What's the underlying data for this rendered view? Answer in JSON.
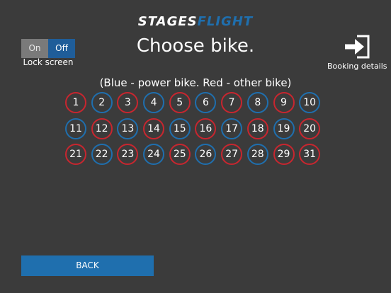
{
  "header": {
    "logo_part1": "STAGES",
    "logo_part2": "FLIGHT",
    "title": "Choose bike."
  },
  "lock": {
    "on_label": "On",
    "off_label": "Off",
    "label": "Lock screen",
    "selected": "Off"
  },
  "booking": {
    "label": "Booking details",
    "icon": "exit-door-arrow-icon"
  },
  "legend": "(Blue - power bike. Red - other bike)",
  "colors": {
    "power_bike": "#1f6fae",
    "other_bike": "#c8262f",
    "background": "#3b3b3b",
    "accent": "#1f6fae"
  },
  "bikes": [
    {
      "number": "1",
      "type": "other"
    },
    {
      "number": "2",
      "type": "power"
    },
    {
      "number": "3",
      "type": "other"
    },
    {
      "number": "4",
      "type": "power"
    },
    {
      "number": "5",
      "type": "other"
    },
    {
      "number": "6",
      "type": "power"
    },
    {
      "number": "7",
      "type": "other"
    },
    {
      "number": "8",
      "type": "power"
    },
    {
      "number": "9",
      "type": "other"
    },
    {
      "number": "10",
      "type": "power"
    },
    {
      "number": "11",
      "type": "power"
    },
    {
      "number": "12",
      "type": "other"
    },
    {
      "number": "13",
      "type": "power"
    },
    {
      "number": "14",
      "type": "other"
    },
    {
      "number": "15",
      "type": "power"
    },
    {
      "number": "16",
      "type": "other"
    },
    {
      "number": "17",
      "type": "power"
    },
    {
      "number": "18",
      "type": "other"
    },
    {
      "number": "19",
      "type": "power"
    },
    {
      "number": "20",
      "type": "other"
    },
    {
      "number": "21",
      "type": "other"
    },
    {
      "number": "22",
      "type": "power"
    },
    {
      "number": "23",
      "type": "other"
    },
    {
      "number": "24",
      "type": "power"
    },
    {
      "number": "25",
      "type": "other"
    },
    {
      "number": "26",
      "type": "power"
    },
    {
      "number": "27",
      "type": "other"
    },
    {
      "number": "28",
      "type": "power"
    },
    {
      "number": "29",
      "type": "other"
    },
    {
      "number": "31",
      "type": "other"
    }
  ],
  "footer": {
    "back_label": "BACK"
  }
}
